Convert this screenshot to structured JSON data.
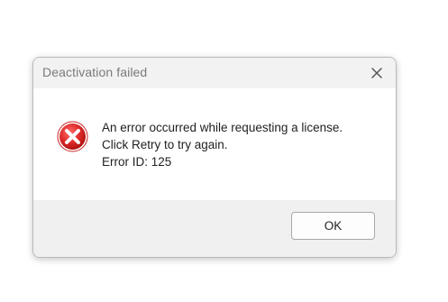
{
  "dialog": {
    "title": "Deactivation failed",
    "close_icon": "close-icon",
    "error_icon": "error-icon",
    "message_lines": [
      "An error occurred while requesting a license.",
      "Click Retry to try again.",
      "Error ID: 125"
    ],
    "ok_label": "OK"
  },
  "colors": {
    "titlebar_background": "#f2f2f2",
    "footer_background": "#f0f0f0",
    "error_red": "#d32f2f",
    "text": "#1f1f1f"
  }
}
